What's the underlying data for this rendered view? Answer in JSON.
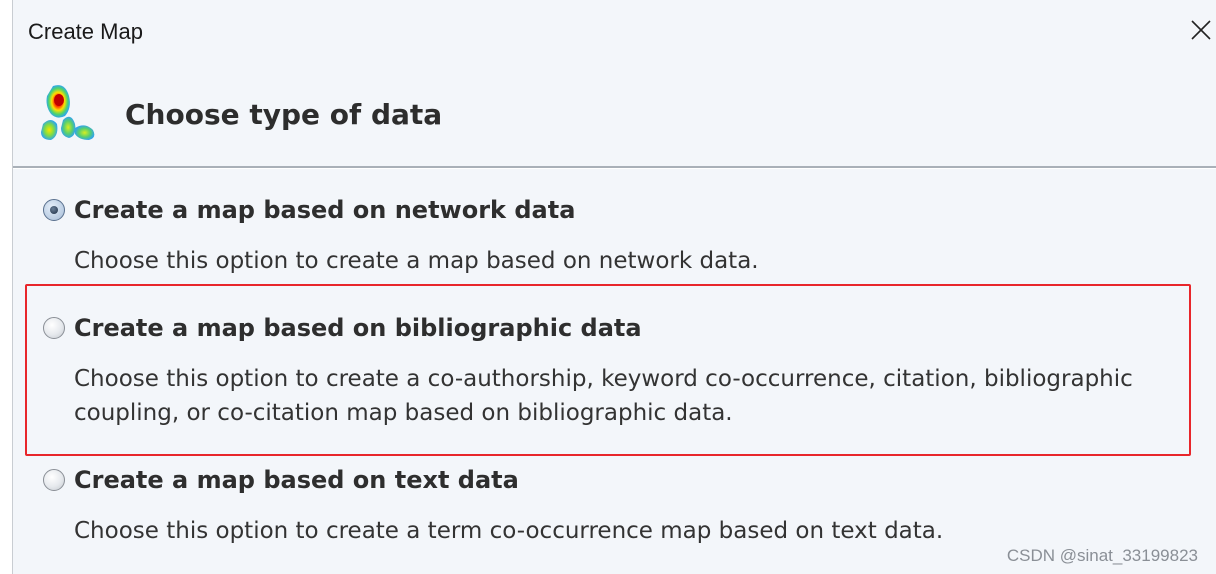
{
  "window": {
    "title": "Create Map"
  },
  "header": {
    "title": "Choose type of data",
    "icon": "vosviewer-heatmap-logo"
  },
  "options": [
    {
      "label": "Create a map based on network data",
      "description": "Choose this option to create a map based on network data.",
      "selected": true
    },
    {
      "label": "Create a map based on bibliographic data",
      "description": "Choose this option to create a co-authorship, keyword co-occurrence, citation, bibliographic coupling, or co-citation map based on bibliographic data.",
      "selected": false
    },
    {
      "label": "Create a map based on text data",
      "description": "Choose this option to create a term co-occurrence map based on text data.",
      "selected": false
    }
  ],
  "watermark": "CSDN @sinat_33199823",
  "colors": {
    "window_bg": "#f3f6fa",
    "highlight": "#e8262b",
    "text": "#2e2e2e"
  }
}
